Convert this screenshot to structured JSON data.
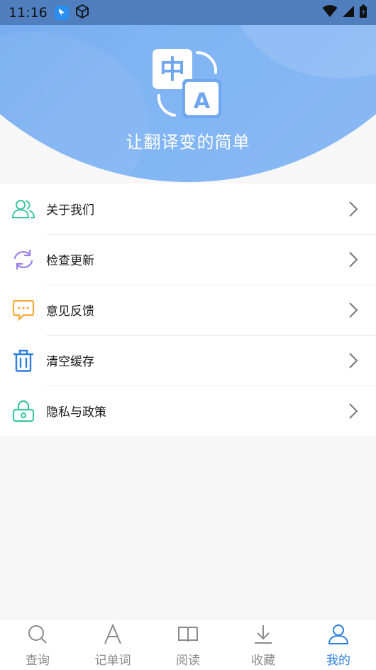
{
  "statusbar": {
    "time": "11:16"
  },
  "hero": {
    "slogan": "让翻译变的简单"
  },
  "logo": {
    "char_zh": "中",
    "char_en": "A"
  },
  "menu": [
    {
      "label": "关于我们",
      "icon": "users-icon"
    },
    {
      "label": "检查更新",
      "icon": "refresh-icon"
    },
    {
      "label": "意见反馈",
      "icon": "chat-bubble-icon"
    },
    {
      "label": "清空缓存",
      "icon": "trash-icon"
    },
    {
      "label": "隐私与政策",
      "icon": "lock-icon"
    }
  ],
  "nav": [
    {
      "label": "查询",
      "icon": "search-icon",
      "active": false
    },
    {
      "label": "记单词",
      "icon": "letter-a-icon",
      "active": false
    },
    {
      "label": "阅读",
      "icon": "book-icon",
      "active": false
    },
    {
      "label": "收藏",
      "icon": "download-icon",
      "active": false
    },
    {
      "label": "我的",
      "icon": "person-icon",
      "active": true
    }
  ],
  "colors": {
    "accent": "#2b7ee0",
    "hero": "#6fa6ee",
    "users": "#3cc6a2",
    "refresh": "#9b7fe6",
    "feedback": "#f7a93c",
    "trash": "#2b7ee0",
    "lock": "#3cc6a2"
  }
}
